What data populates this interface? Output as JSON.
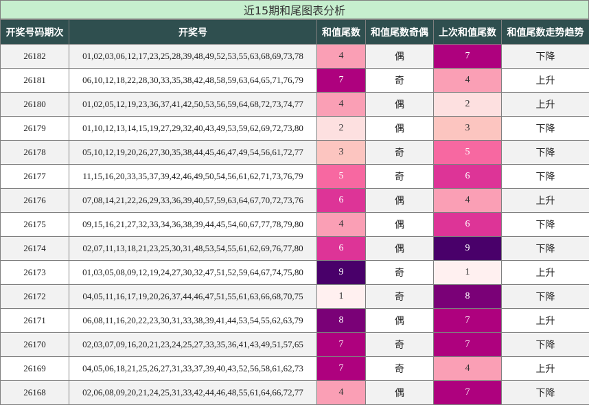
{
  "title": "近15期和尾图表分析",
  "headers": [
    "开奖号码期次",
    "开奖号",
    "和值尾数",
    "和值尾数奇偶",
    "上次和值尾数",
    "和值尾数走势趋势"
  ],
  "heat_colors": {
    "1": "#fff0f0",
    "2": "#fde0e0",
    "3": "#fcc5c0",
    "4": "#fa9fb5",
    "5": "#f768a1",
    "6": "#dd3497",
    "7": "#ae017e",
    "8": "#7a0177",
    "9": "#49006a"
  },
  "rows": [
    {
      "issue": "26182",
      "numbers": "01,02,03,06,12,17,23,25,28,39,48,49,52,53,55,63,68,69,73,78",
      "tail": "4",
      "parity": "偶",
      "prev_tail": "7",
      "trend": "下降"
    },
    {
      "issue": "26181",
      "numbers": "06,10,12,18,22,28,30,33,35,38,42,48,58,59,63,64,65,71,76,79",
      "tail": "7",
      "parity": "奇",
      "prev_tail": "4",
      "trend": "上升"
    },
    {
      "issue": "26180",
      "numbers": "01,02,05,12,19,23,36,37,41,42,50,53,56,59,64,68,72,73,74,77",
      "tail": "4",
      "parity": "偶",
      "prev_tail": "2",
      "trend": "上升"
    },
    {
      "issue": "26179",
      "numbers": "01,10,12,13,14,15,19,27,29,32,40,43,49,53,59,62,69,72,73,80",
      "tail": "2",
      "parity": "偶",
      "prev_tail": "3",
      "trend": "下降"
    },
    {
      "issue": "26178",
      "numbers": "05,10,12,19,20,26,27,30,35,38,44,45,46,47,49,54,56,61,72,77",
      "tail": "3",
      "parity": "奇",
      "prev_tail": "5",
      "trend": "下降"
    },
    {
      "issue": "26177",
      "numbers": "11,15,16,20,33,35,37,39,42,46,49,50,54,56,61,62,71,73,76,79",
      "tail": "5",
      "parity": "奇",
      "prev_tail": "6",
      "trend": "下降"
    },
    {
      "issue": "26176",
      "numbers": "07,08,14,21,22,26,29,33,36,39,40,57,59,63,64,67,70,72,73,76",
      "tail": "6",
      "parity": "偶",
      "prev_tail": "4",
      "trend": "上升"
    },
    {
      "issue": "26175",
      "numbers": "09,15,16,21,27,32,33,34,36,38,39,44,45,54,60,67,77,78,79,80",
      "tail": "4",
      "parity": "偶",
      "prev_tail": "6",
      "trend": "下降"
    },
    {
      "issue": "26174",
      "numbers": "02,07,11,13,18,21,23,25,30,31,48,53,54,55,61,62,69,76,77,80",
      "tail": "6",
      "parity": "偶",
      "prev_tail": "9",
      "trend": "下降"
    },
    {
      "issue": "26173",
      "numbers": "01,03,05,08,09,12,19,24,27,30,32,47,51,52,59,64,67,74,75,80",
      "tail": "9",
      "parity": "奇",
      "prev_tail": "1",
      "trend": "上升"
    },
    {
      "issue": "26172",
      "numbers": "04,05,11,16,17,19,20,26,37,44,46,47,51,55,61,63,66,68,70,75",
      "tail": "1",
      "parity": "奇",
      "prev_tail": "8",
      "trend": "下降"
    },
    {
      "issue": "26171",
      "numbers": "06,08,11,16,20,22,23,30,31,33,38,39,41,44,53,54,55,62,63,79",
      "tail": "8",
      "parity": "偶",
      "prev_tail": "7",
      "trend": "上升"
    },
    {
      "issue": "26170",
      "numbers": "02,03,07,09,16,20,21,23,24,25,27,33,35,36,41,43,49,51,57,65",
      "tail": "7",
      "parity": "奇",
      "prev_tail": "7",
      "trend": "下降"
    },
    {
      "issue": "26169",
      "numbers": "04,05,06,18,21,25,26,27,31,33,37,39,40,43,52,56,58,61,62,73",
      "tail": "7",
      "parity": "奇",
      "prev_tail": "4",
      "trend": "上升"
    },
    {
      "issue": "26168",
      "numbers": "02,06,08,09,20,21,24,25,31,33,42,44,46,48,55,61,64,66,72,77",
      "tail": "4",
      "parity": "偶",
      "prev_tail": "7",
      "trend": "下降"
    }
  ]
}
